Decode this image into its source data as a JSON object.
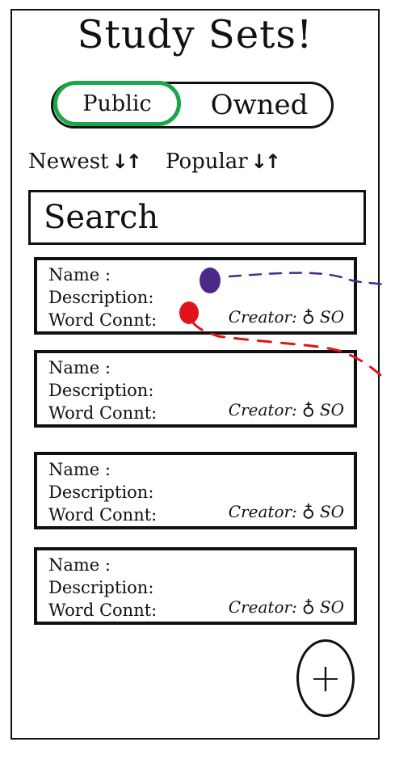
{
  "title": "Study Sets!",
  "toggle": {
    "public_label": "Public",
    "owned_label": "Owned",
    "selected": "Public",
    "highlight_color": "#1aa64a"
  },
  "sort": {
    "newest_label": "Newest",
    "popular_label": "Popular",
    "arrows": "↓↑"
  },
  "search": {
    "placeholder": "Search"
  },
  "cards": [
    {
      "name_label": "Name :",
      "description_label": "Description:",
      "word_count_label": "Word Connt:",
      "creator_label": "Creator:",
      "creator_icon": "user-icon",
      "creator_value": "SO"
    },
    {
      "name_label": "Name :",
      "description_label": "Description:",
      "word_count_label": "Word Connt:",
      "creator_label": "Creator:",
      "creator_icon": "user-icon",
      "creator_value": "SO"
    },
    {
      "name_label": "Name :",
      "description_label": "Description:",
      "word_count_label": "Word Connt:",
      "creator_label": "Creator:",
      "creator_icon": "user-icon",
      "creator_value": "SO"
    },
    {
      "name_label": "Name :",
      "description_label": "Description:",
      "word_count_label": "Word Connt:",
      "creator_label": "Creator:",
      "creator_icon": "user-icon",
      "creator_value": "SO"
    }
  ],
  "annotations": {
    "purple_color": "#4b2a86",
    "red_color": "#e0141a"
  },
  "fab": {
    "icon": "plus-icon",
    "label": "+"
  }
}
